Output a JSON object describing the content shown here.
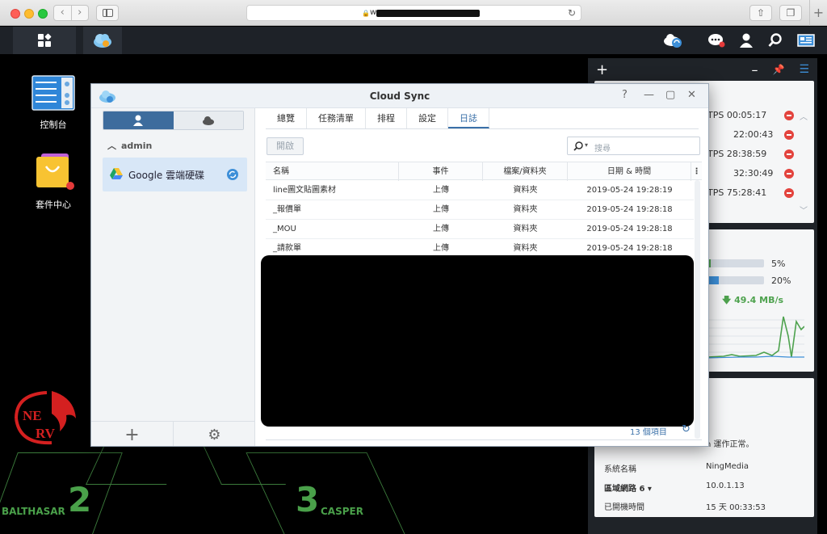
{
  "browser": {
    "url_prefix": "w"
  },
  "desktop": {
    "icons": [
      {
        "label": "控制台"
      },
      {
        "label": "套件中心"
      }
    ],
    "magi": {
      "balthasar": "BALTHASAR",
      "balthasar_num": "2",
      "casper": "CASPER",
      "casper_num": "3"
    }
  },
  "widgets": {
    "connections": [
      {
        "time": "TPS 00:05:17"
      },
      {
        "time": "22:00:43"
      },
      {
        "time": "TPS 28:38:59"
      },
      {
        "time": "32:30:49"
      },
      {
        "time": "TPS 75:28:41"
      }
    ],
    "resource": {
      "cpu_percent": "5%",
      "cpu_value": 0.05,
      "ram_percent": "20%",
      "ram_value": 0.2,
      "network": "49.4 MB/s"
    },
    "health": {
      "status_suffix": "n 運作正常。",
      "rows": [
        {
          "label": "系統名稱",
          "value": "NingMedia"
        },
        {
          "label": "區域網路 6 ▾",
          "value": "10.0.1.13"
        },
        {
          "label": "已開機時間",
          "value": "15 天 00:33:53"
        }
      ]
    }
  },
  "window": {
    "title": "Cloud Sync",
    "account": "admin",
    "connection": "Google 雲端硬碟",
    "tabs": [
      {
        "label": "總覽"
      },
      {
        "label": "任務清單"
      },
      {
        "label": "排程"
      },
      {
        "label": "設定"
      },
      {
        "label": "日誌"
      }
    ],
    "open_button": "開啟",
    "search_placeholder": "搜尋",
    "columns": {
      "name": "名稱",
      "event": "事件",
      "type": "檔案/資料夾",
      "datetime": "日期 & 時間"
    },
    "rows": [
      {
        "name": "line圖文貼圖素材",
        "event": "上傳",
        "type": "資料夾",
        "datetime": "2019-05-24 19:28:19"
      },
      {
        "name": "_報價單",
        "event": "上傳",
        "type": "資料夾",
        "datetime": "2019-05-24 19:28:18"
      },
      {
        "name": "_MOU",
        "event": "上傳",
        "type": "資料夾",
        "datetime": "2019-05-24 19:28:18"
      },
      {
        "name": "_請款單",
        "event": "上傳",
        "type": "資料夾",
        "datetime": "2019-05-24 19:28:18"
      }
    ],
    "item_count": "13 個項目"
  }
}
